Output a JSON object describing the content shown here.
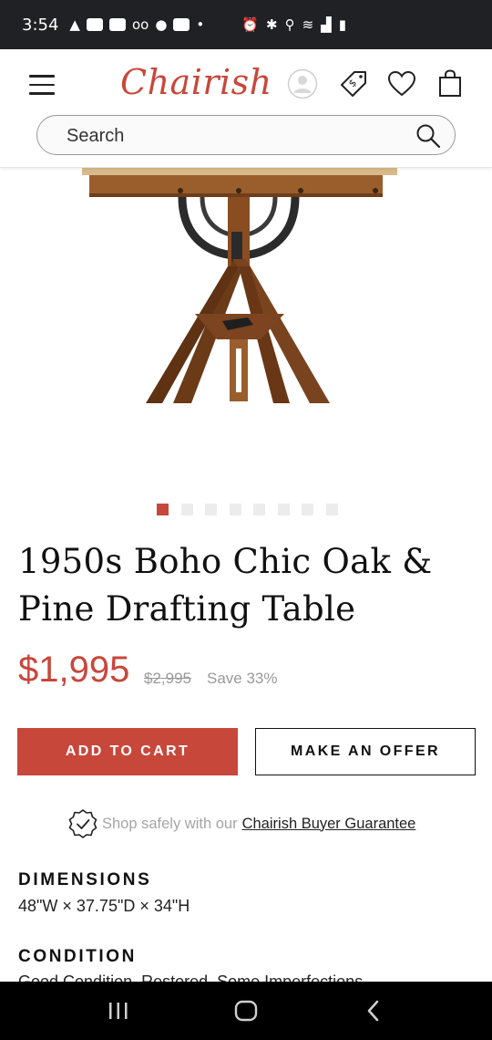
{
  "status_bar": {
    "time": "3:54"
  },
  "header": {
    "logo": "Chairish",
    "search": {
      "placeholder": "Search",
      "value": ""
    }
  },
  "carousel": {
    "total": 8,
    "active_index": 0,
    "active_color": "#c8473b",
    "inactive_color": "#ececec"
  },
  "product": {
    "title": "1950s Boho Chic Oak & Pine Drafting Table",
    "price": "$1,995",
    "original_price": "$2,995",
    "save_text": "Save 33%"
  },
  "buttons": {
    "add_to_cart": "ADD TO CART",
    "make_offer": "MAKE AN OFFER"
  },
  "guarantee": {
    "text": "Shop safely with our",
    "link": "Chairish Buyer Guarantee"
  },
  "specs": {
    "dimensions_label": "DIMENSIONS",
    "dimensions_value": "48\"W × 37.75\"D × 34\"H",
    "condition_label": "CONDITION",
    "condition_value": "Good Condition. Restored. Some Imperfections."
  },
  "colors": {
    "brand": "#c8473b",
    "text": "#111111",
    "muted": "#9a9a9a"
  }
}
